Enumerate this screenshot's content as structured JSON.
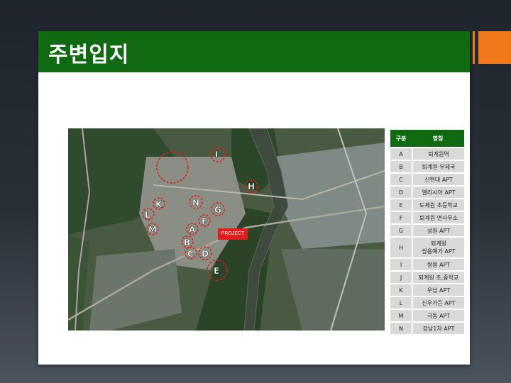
{
  "slide": {
    "title": "주변입지"
  },
  "map": {
    "project_label": "PROJECT",
    "markers": [
      "A",
      "B",
      "C",
      "D",
      "E",
      "F",
      "G",
      "H",
      "I",
      "J",
      "K",
      "L",
      "M",
      "N"
    ]
  },
  "legend": {
    "header": {
      "category": "구분",
      "name": "명칭"
    },
    "rows": [
      {
        "id": "A",
        "name": "퇴계원역"
      },
      {
        "id": "B",
        "name": "퇴계원 우체국"
      },
      {
        "id": "C",
        "name": "신현대 APT"
      },
      {
        "id": "D",
        "name": "엘리시아 APT"
      },
      {
        "id": "E",
        "name": "도제원 초등학교"
      },
      {
        "id": "F",
        "name": "퇴계원 면사무소"
      },
      {
        "id": "G",
        "name": "성원 APT"
      },
      {
        "id": "H",
        "name_line1": "퇴계원",
        "name_line2": "쌍용예가 APT"
      },
      {
        "id": "I",
        "name": "쌍용 APT"
      },
      {
        "id": "J",
        "name": "퇴계원 초,중학교"
      },
      {
        "id": "K",
        "name": "우남 APT"
      },
      {
        "id": "L",
        "name": "신우가든 APT"
      },
      {
        "id": "M",
        "name": "극동 APT"
      },
      {
        "id": "N",
        "name": "강남1차 APT"
      }
    ]
  },
  "colors": {
    "title_green": "#0f6a12",
    "accent_orange": "#f07a1a",
    "marker_red": "#e31b1b"
  }
}
